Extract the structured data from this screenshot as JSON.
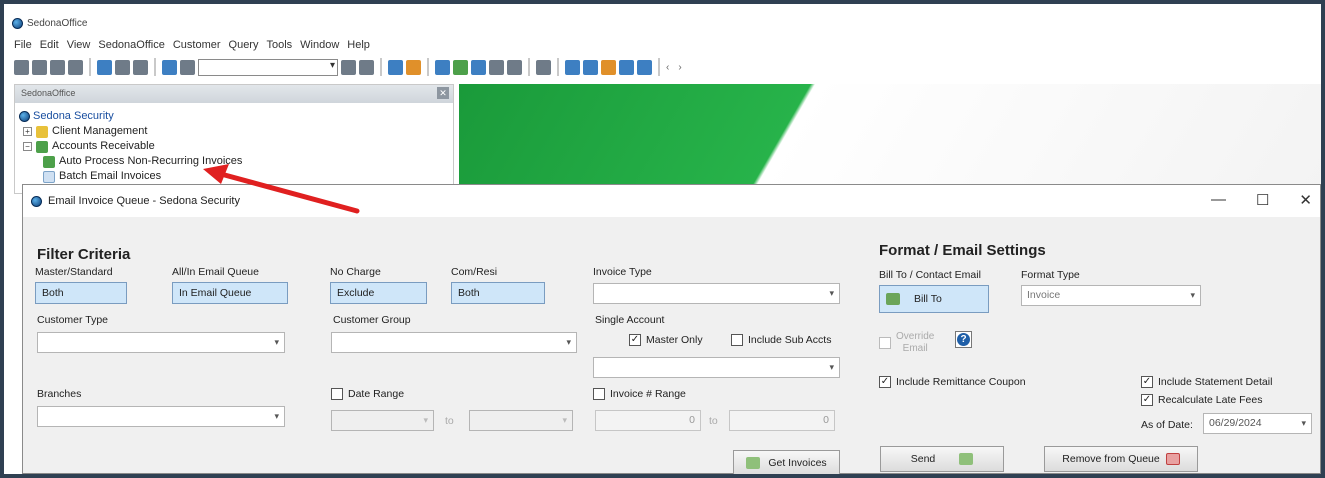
{
  "app": {
    "title": "SedonaOffice",
    "menu": [
      "File",
      "Edit",
      "View",
      "SedonaOffice",
      "Customer",
      "Query",
      "Tools",
      "Window",
      "Help"
    ]
  },
  "tree_panel": {
    "header": "SedonaOffice",
    "root": "Sedona Security",
    "items": [
      {
        "label": "Client Management"
      },
      {
        "label": "Accounts Receivable"
      },
      {
        "label": "Auto Process Non-Recurring Invoices"
      },
      {
        "label": "Batch Email Invoices"
      }
    ]
  },
  "dialog": {
    "title": "Email Invoice Queue - Sedona Security",
    "controls": {
      "minimize": "—",
      "maximize": "☐",
      "close": "✕"
    }
  },
  "filter": {
    "heading": "Filter Criteria",
    "master_standard": {
      "label": "Master/Standard",
      "value": "Both"
    },
    "all_in_email_queue": {
      "label": "All/In Email Queue",
      "value": "In Email Queue"
    },
    "no_charge": {
      "label": "No Charge",
      "value": "Exclude"
    },
    "com_resi": {
      "label": "Com/Resi",
      "value": "Both"
    },
    "invoice_type": {
      "label": "Invoice Type",
      "value": ""
    },
    "customer_type": {
      "label": "Customer Type",
      "value": ""
    },
    "customer_group": {
      "label": "Customer Group",
      "value": ""
    },
    "single_account": {
      "label": "Single Account",
      "value": ""
    },
    "master_only": {
      "label": "Master Only",
      "checked": true
    },
    "include_sub_accts": {
      "label": "Include Sub Accts",
      "checked": false
    },
    "branches": {
      "label": "Branches",
      "value": ""
    },
    "date_range": {
      "label": "Date Range",
      "checked": false,
      "to_label": "to"
    },
    "invoice_range": {
      "label": "Invoice # Range",
      "checked": false,
      "from": "0",
      "to_label": "to",
      "to": "0"
    },
    "get_invoices_label": "Get Invoices"
  },
  "format": {
    "heading": "Format / Email Settings",
    "bill_to_label": "Bill To / Contact Email",
    "bill_to_value": "Bill To",
    "format_type_label": "Format Type",
    "format_type_value": "Invoice",
    "override_email_label_1": "Override",
    "override_email_label_2": "Email",
    "include_remittance": {
      "label": "Include Remittance Coupon",
      "checked": true
    },
    "include_statement_detail": {
      "label": "Include Statement Detail",
      "checked": true
    },
    "recalculate_late_fees": {
      "label": "Recalculate Late Fees",
      "checked": true
    },
    "as_of_date_label": "As of Date:",
    "as_of_date_value": "06/29/2024",
    "send_label": "Send",
    "remove_label": "Remove from Queue"
  },
  "colors": {
    "accent_blue": "#cfe6f9",
    "annotation_arrow": "#e02020",
    "brand_green": "#27b34a"
  }
}
